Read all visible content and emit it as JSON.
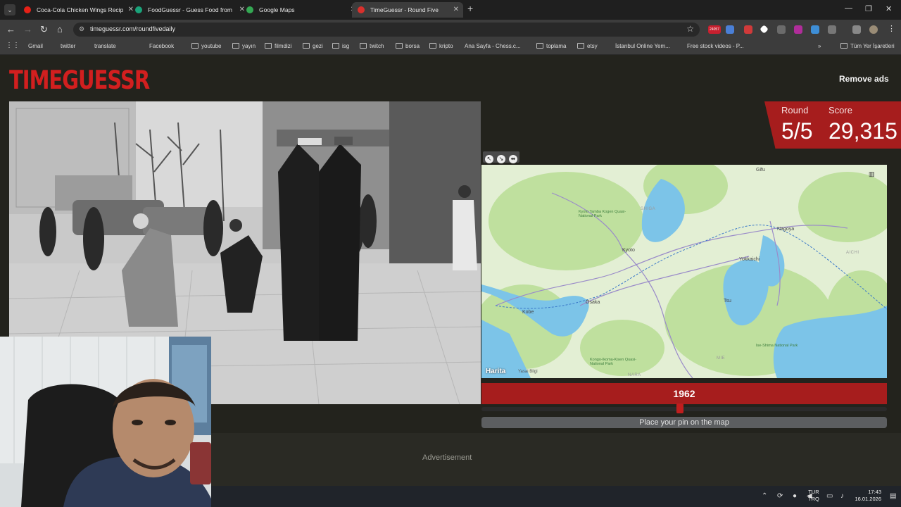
{
  "browser": {
    "tabs": [
      {
        "title": "Coca-Cola Chicken Wings Recip",
        "favicon_color": "#e62117",
        "active": false
      },
      {
        "title": "FoodGuessr - Guess Food from",
        "favicon_color": "#1aa37a",
        "active": false
      },
      {
        "title": "Google Maps",
        "favicon_color": "#34a853",
        "active": false
      },
      {
        "title": "TimeGuessr - Round Five",
        "favicon_color": "#d9302c",
        "active": true
      }
    ],
    "url": "timeguessr.com/roundfivedaily",
    "notification_count": "24057",
    "bookmarks": [
      "Gmail",
      "twitter",
      "translate",
      "Facebook",
      "youtube",
      "yayın",
      "filmdizi",
      "gezi",
      "isg",
      "twitch",
      "borsa",
      "kripto",
      "Ana Sayfa - Chess.c...",
      "toplama",
      "etsy",
      "İstanbul Online Yem...",
      "Free stock videos - P..."
    ],
    "all_bookmarks": "Tüm Yer İşaretleri"
  },
  "game": {
    "logo": "TIMEGUESSR",
    "remove_ads": "Remove ads",
    "round_label": "Round",
    "round_value": "5/5",
    "score_label": "Score",
    "score_value": "29,315",
    "year": "1962",
    "year_slider_fraction": 0.49,
    "place_pin": "Place your pin on the map",
    "advertisement": "Advertisement",
    "accent_color": "#a61d1d"
  },
  "map": {
    "attribution": "Harita",
    "legal": "Yasal Bilgi",
    "cities": [
      "Nagoya",
      "Kyoto",
      "Osaka",
      "Kobe",
      "Yokkaichi",
      "Tsu",
      "Gifu"
    ],
    "prefectures": [
      "SHIGA",
      "AICHI",
      "MIE",
      "NARA"
    ],
    "parks": [
      "Kyoto Tamba Kogen Quasi-National Park",
      "Ise-Shima National Park",
      "Kongo-Ikoma-Kisen Quasi-National Park"
    ]
  },
  "system": {
    "language": "TUR",
    "language_sub": "TRQ",
    "time": "17:43",
    "date": "16.01.2026"
  }
}
